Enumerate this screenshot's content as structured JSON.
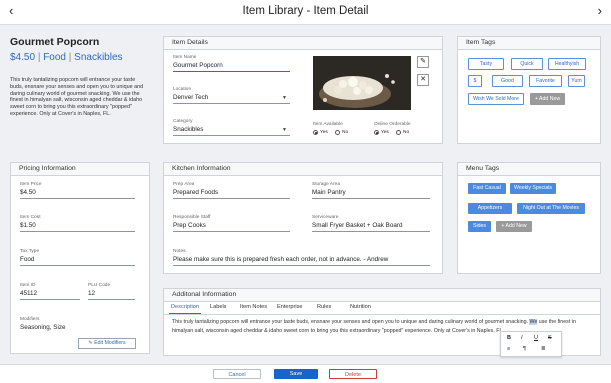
{
  "header": {
    "title": "Item Library - Item Detail",
    "back_glyph": "‹",
    "forward_glyph": "›"
  },
  "summary": {
    "name": "Gourmet Popcorn",
    "price": "$4.50",
    "categories": [
      "Food",
      "Snackibles"
    ],
    "separator": "|",
    "description": "This truly tantalizing popcorn will entrance your taste buds, ensnare your senses and open you to unique and daring culinary world of gourmet snacking. We use the finest in himalyan salt, wisconsin aged cheddar & idaho sweet corn to bring you this extraordinary \"popped\" experience.  Only at Cover's in Naples, FL."
  },
  "item_details": {
    "title": "Item Details",
    "name_label": "Item Name",
    "name_value": "Gourmet Popcorn",
    "location_label": "Location",
    "location_value": "Denver Tech",
    "category_label": "Category",
    "category_value": "Snackibles",
    "available_label": "Item Available",
    "online_label": "Online Orderable",
    "yes": "Yes",
    "no": "No"
  },
  "item_tags": {
    "title": "Item Tags",
    "tags": [
      "Tasty",
      "Quick",
      "Healthyish",
      "$",
      "Good",
      "Favorite",
      "Yum",
      "Wish We Sold More"
    ],
    "add_label": "+ Add New"
  },
  "pricing": {
    "title": "Pricing Information",
    "price_label": "Item Price",
    "price_value": "$4.50",
    "cost_label": "Item Cost",
    "cost_value": "$1.50",
    "tax_label": "Tax Type",
    "tax_value": "Food",
    "id_label": "Item ID",
    "id_value": "45112",
    "plu_label": "PLU Code",
    "plu_value": "12",
    "modifiers_label": "Modifiers",
    "modifiers_value": "Seasoning, Size",
    "edit_label": "Edit Modifiers"
  },
  "kitchen": {
    "title": "Kitchen Information",
    "prep_area_label": "Prep Area",
    "prep_area_value": "Prepared Foods",
    "store_area_label": "Storage Area",
    "store_area_value": "Main Pantry",
    "staff_label": "Responsible Staff",
    "staff_value": "Prep Cooks",
    "serviceware_label": "Serviceware",
    "serviceware_value": "Small Fryer Basket + Oak Board",
    "notes_label": "Notes",
    "notes_value": "Please make sure this is prepared fresh each order, not in advance. - Andrew"
  },
  "menu_tags": {
    "title": "Menu Tags",
    "tags": [
      "Fast Casual",
      "Weekly Specials",
      "Appetizers",
      "Night Out at The Movies",
      "Sides"
    ],
    "add_label": "+ Add New"
  },
  "additional": {
    "title": "Additonal Information",
    "tabs": [
      "Description",
      "Labels",
      "Item Notes",
      "Enterprise",
      "Rules",
      "Nutrition"
    ],
    "text_before": "This truly tantalizing popcorn will entrance your taste buds, ensnare your senses and open you to unique and daring culinary world of gourmet snacking. ",
    "text_highlight": "We",
    "text_after": " use the finest in himalyan salt, wisconsin aged cheddar & idaho sweet corn to bring you this extraordinary \"popped\" experience.  Only at Cover's in Naples, FL.",
    "toolbar": [
      "B",
      "I",
      "U",
      "S",
      "≡",
      "¶",
      "≣"
    ]
  },
  "footer": {
    "cancel": "Cancel",
    "save": "Save",
    "delete": "Delete"
  },
  "colors": {
    "accent": "#2f6bc0",
    "tag_fill": "#4a8ae0",
    "save_bg": "#1a63c9",
    "delete": "#d0393b"
  }
}
